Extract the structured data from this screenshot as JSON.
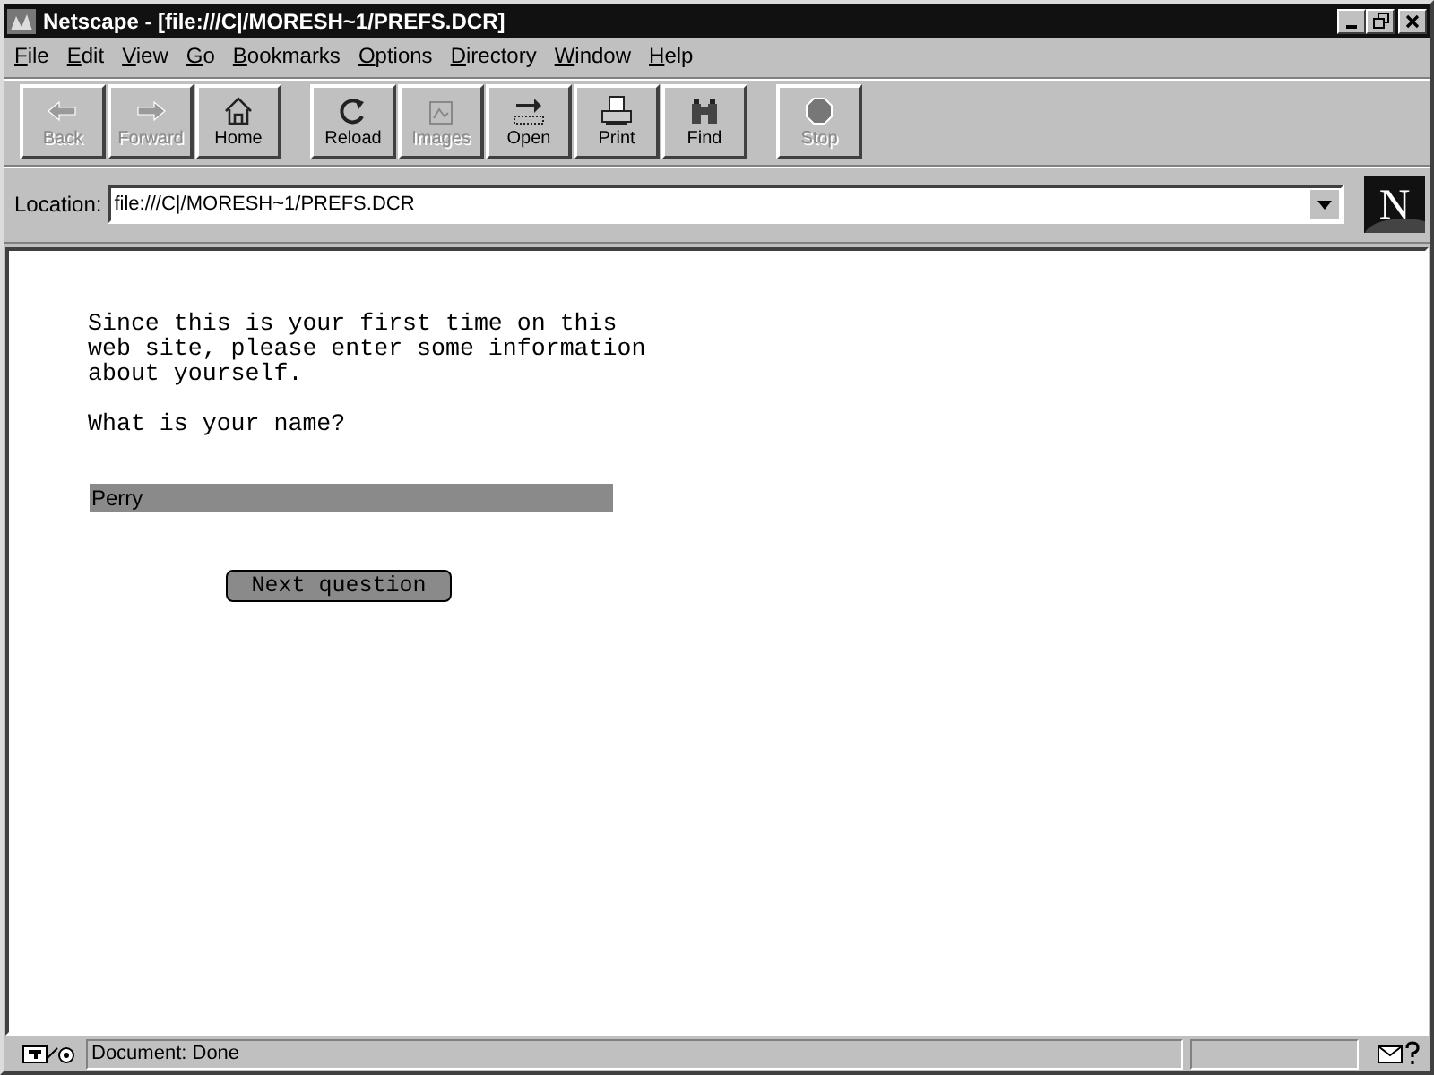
{
  "window": {
    "title": "Netscape - [file:///C|/MORESH~1/PREFS.DCR]"
  },
  "menu": [
    "File",
    "Edit",
    "View",
    "Go",
    "Bookmarks",
    "Options",
    "Directory",
    "Window",
    "Help"
  ],
  "toolbar": [
    [
      {
        "label": "Back",
        "disabled": true
      },
      {
        "label": "Forward",
        "disabled": true
      },
      {
        "label": "Home",
        "disabled": false
      }
    ],
    [
      {
        "label": "Reload",
        "disabled": false
      },
      {
        "label": "Images",
        "disabled": true
      },
      {
        "label": "Open",
        "disabled": false
      },
      {
        "label": "Print",
        "disabled": false
      },
      {
        "label": "Find",
        "disabled": false
      }
    ],
    [
      {
        "label": "Stop",
        "disabled": true
      }
    ]
  ],
  "location": {
    "label": "Location:",
    "value": "file:///C|/MORESH~1/PREFS.DCR",
    "logo": "N"
  },
  "content": {
    "intro": "Since this is your first time on this web site, please enter some information about yourself.",
    "question": "What is your name?",
    "name_value": "Perry",
    "button": "Next question"
  },
  "status_bar": {
    "text": "Document: Done"
  }
}
